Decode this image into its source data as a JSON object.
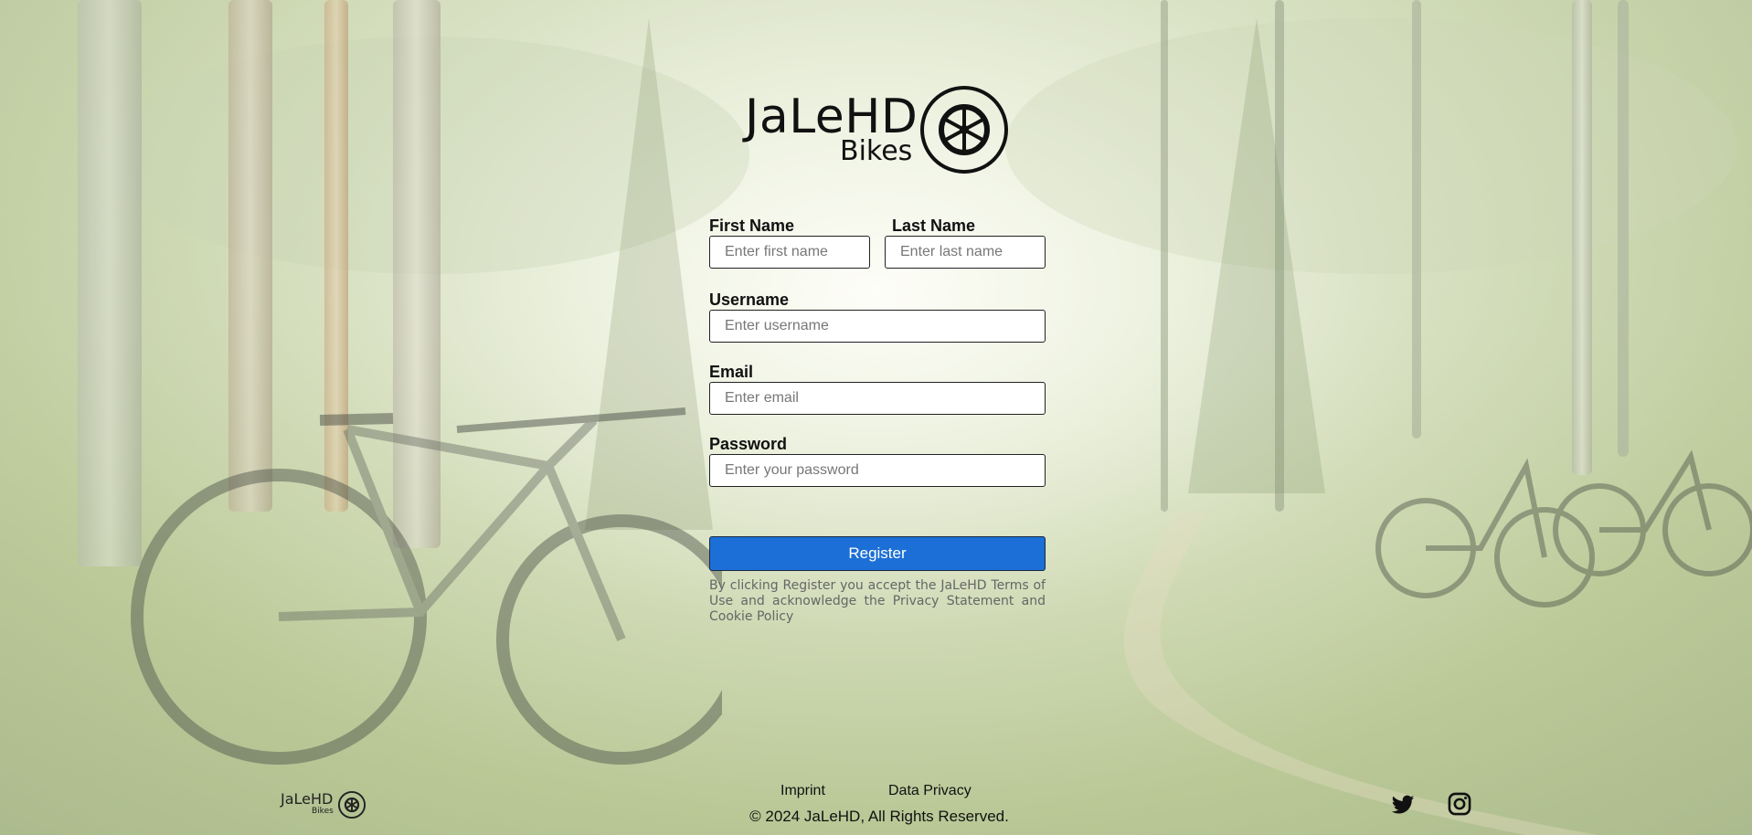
{
  "brand": {
    "name": "JaLeHD",
    "sub": "Bikes"
  },
  "form": {
    "first_name": {
      "label": "First Name",
      "placeholder": "Enter first name",
      "value": ""
    },
    "last_name": {
      "label": "Last Name",
      "placeholder": "Enter last name",
      "value": ""
    },
    "username": {
      "label": "Username",
      "placeholder": "Enter username",
      "value": ""
    },
    "email": {
      "label": "Email",
      "placeholder": "Enter email",
      "value": ""
    },
    "password": {
      "label": "Password",
      "placeholder": "Enter your password",
      "value": ""
    },
    "register_label": "Register",
    "terms_text": "By clicking Register you accept the JaLeHD Terms of Use and acknowledge the Privacy Statement and Cookie Policy"
  },
  "footer": {
    "brand": "JaLeHD",
    "brand_sub": "Bikes",
    "links": [
      {
        "label": "Imprint"
      },
      {
        "label": "Data Privacy"
      }
    ],
    "copyright": "© 2024 JaLeHD, All Rights Reserved.",
    "social": [
      {
        "icon": "twitter-icon"
      },
      {
        "icon": "instagram-icon"
      }
    ]
  },
  "colors": {
    "accent": "#1c6fd6",
    "text": "#111111",
    "muted": "#666666"
  }
}
